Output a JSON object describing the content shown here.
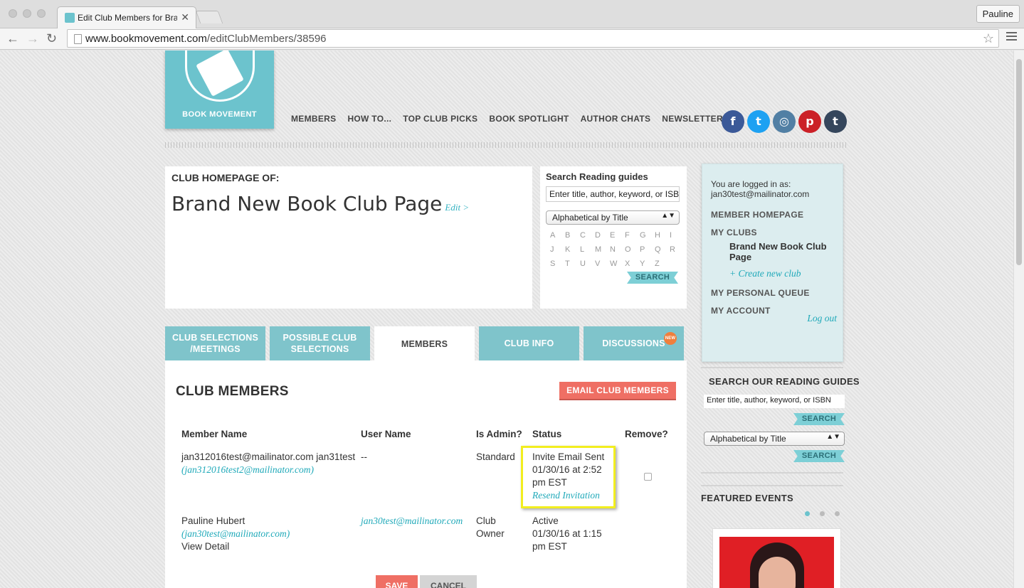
{
  "browser": {
    "tab_title": "Edit Club Members for Brand New Book Club Page",
    "profile": "Pauline",
    "url_host": "www.bookmovement.com",
    "url_path": "/editClubMembers/38596"
  },
  "header": {
    "logo_text": "BOOK MOVEMENT",
    "nav": [
      "MEMBERS",
      "HOW TO...",
      "TOP CLUB PICKS",
      "BOOK SPOTLIGHT",
      "AUTHOR CHATS",
      "NEWSLETTER"
    ],
    "social": [
      {
        "name": "facebook",
        "glyph": "f",
        "color": "#3b5998"
      },
      {
        "name": "twitter",
        "glyph": "t",
        "color": "#1da1f2"
      },
      {
        "name": "instagram",
        "glyph": "◎",
        "color": "#517fa4"
      },
      {
        "name": "pinterest",
        "glyph": "p",
        "color": "#cb2027"
      },
      {
        "name": "tumblr",
        "glyph": "t",
        "color": "#35465c"
      }
    ]
  },
  "club_header": {
    "label": "CLUB HOMEPAGE OF:",
    "name": "Brand New Book Club Page",
    "edit": "Edit >"
  },
  "reading_guides": {
    "title": "Search Reading guides",
    "placeholder": "Enter title, author, keyword, or ISBN",
    "sort": "Alphabetical by Title",
    "letters_row1": [
      "A",
      "B",
      "C",
      "D",
      "E",
      "F",
      "G",
      "H",
      "I"
    ],
    "letters_row2": [
      "J",
      "K",
      "L",
      "M",
      "N",
      "O",
      "P",
      "Q",
      "R"
    ],
    "letters_row3": [
      "S",
      "T",
      "U",
      "V",
      "W",
      "X",
      "Y",
      "Z"
    ],
    "search": "SEARCH"
  },
  "tabs": {
    "selections_line1": "CLUB SELECTIONS",
    "selections_line2": "/MEETINGS",
    "possible_line1": "POSSIBLE CLUB",
    "possible_line2": "SELECTIONS",
    "members": "MEMBERS",
    "info": "CLUB INFO",
    "discussions": "DISCUSSIONS",
    "new_badge": "NEW"
  },
  "members": {
    "title": "CLUB MEMBERS",
    "email_button": "EMAIL CLUB MEMBERS",
    "columns": [
      "Member Name",
      "User Name",
      "Is Admin?",
      "Status",
      "Remove?"
    ],
    "rows": [
      {
        "name": "jan312016test@mailinator.com jan31test",
        "email": "(jan312016test2@mailinator.com)",
        "username": "--",
        "admin": "Standard",
        "status_line1": "Invite Email Sent",
        "status_line2": "01/30/16 at 2:52",
        "status_line3": "pm EST",
        "resend": "Resend Invitation"
      },
      {
        "name": "Pauline Hubert",
        "email": "(jan30test@mailinator.com)",
        "detail": "View Detail",
        "username": "jan30test@mailinator.com",
        "admin_line1": "Club",
        "admin_line2": "Owner",
        "status_line1": "Active",
        "status_line2": "01/30/16 at 1:15",
        "status_line3": "pm EST"
      }
    ],
    "save": "SAVE",
    "cancel": "CANCEL"
  },
  "sidebar": {
    "logged_in_label": "You are logged in as:",
    "logged_in_email": "jan30test@mailinator.com",
    "member_home": "MEMBER HOMEPAGE",
    "my_clubs": "MY CLUBS",
    "club_name": "Brand New Book Club Page",
    "create_club": "+ Create new club",
    "personal_queue": "MY PERSONAL QUEUE",
    "account": "MY ACCOUNT",
    "logout": "Log out",
    "search_title": "SEARCH OUR READING GUIDES",
    "search_placeholder": "Enter title, author, keyword, or ISBN",
    "search": "SEARCH",
    "sort": "Alphabetical by Title",
    "featured_title": "FEATURED EVENTS"
  }
}
